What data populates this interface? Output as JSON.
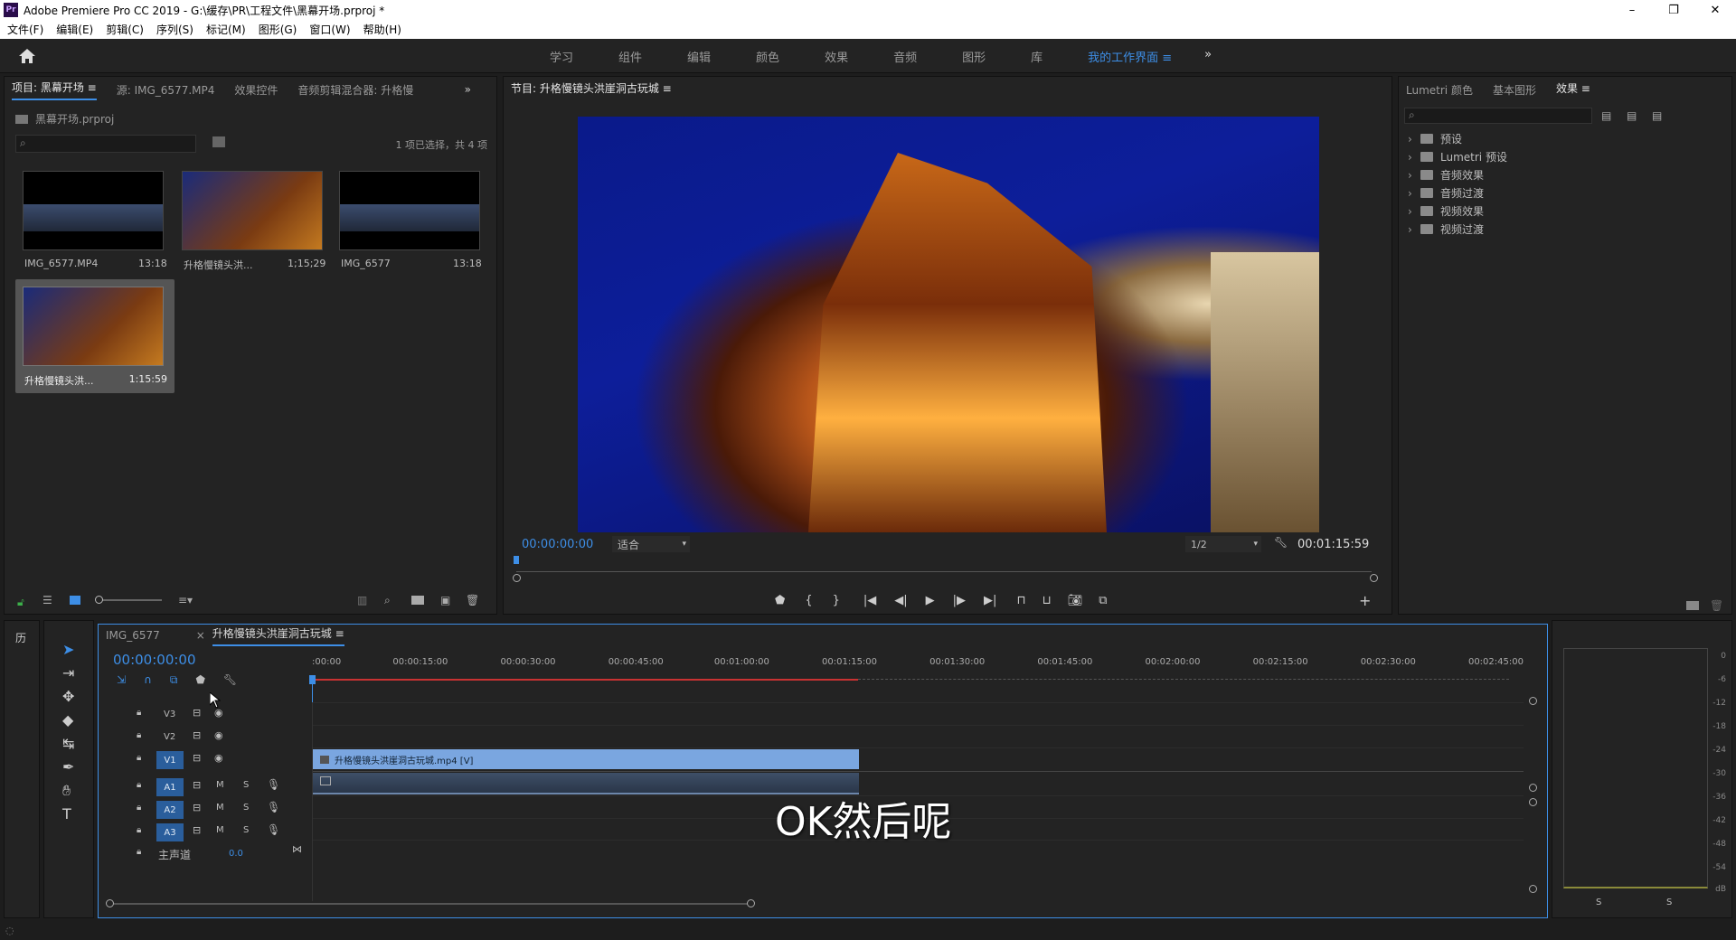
{
  "window": {
    "title": "Adobe Premiere Pro CC 2019 - G:\\缓存\\PR\\工程文件\\黑幕开场.prproj *",
    "logo": "Pr"
  },
  "menu": [
    "文件(F)",
    "编辑(E)",
    "剪辑(C)",
    "序列(S)",
    "标记(M)",
    "图形(G)",
    "窗口(W)",
    "帮助(H)"
  ],
  "workspaces": {
    "items": [
      "学习",
      "组件",
      "编辑",
      "颜色",
      "效果",
      "音频",
      "图形",
      "库"
    ],
    "active": "我的工作界面",
    "more": "»"
  },
  "project": {
    "tabs": [
      "项目: 黑幕开场",
      "源: IMG_6577.MP4",
      "效果控件",
      "音频剪辑混合器: 升格慢"
    ],
    "file": "黑幕开场.prproj",
    "selection_info": "1 项已选择，共 4 项",
    "items": [
      {
        "name": "IMG_6577.MP4",
        "duration": "13:18"
      },
      {
        "name": "升格慢镜头洪...",
        "duration": "1;15;29"
      },
      {
        "name": "IMG_6577",
        "duration": "13:18"
      },
      {
        "name": "升格慢镜头洪...",
        "duration": "1:15:59"
      }
    ]
  },
  "program": {
    "title": "节目: 升格慢镜头洪崖洞古玩城",
    "timecode": "00:00:00:00",
    "fit": "适合",
    "resolution": "1/2",
    "duration": "00:01:15:59"
  },
  "effects": {
    "tabs": [
      "Lumetri 颜色",
      "基本图形",
      "效果"
    ],
    "folders": [
      "预设",
      "Lumetri 预设",
      "音频效果",
      "音频过渡",
      "视频效果",
      "视频过渡"
    ]
  },
  "timeline": {
    "tabs": [
      "IMG_6577",
      "升格慢镜头洪崖洞古玩城"
    ],
    "timecode": "00:00:00:00",
    "ruler": [
      ":00:00",
      "00:00:15:00",
      "00:00:30:00",
      "00:00:45:00",
      "00:01:00:00",
      "00:01:15:00",
      "00:01:30:00",
      "00:01:45:00",
      "00:02:00:00",
      "00:02:15:00",
      "00:02:30:00",
      "00:02:45:00"
    ],
    "video_tracks": [
      "V3",
      "V2",
      "V1"
    ],
    "audio_tracks": [
      "A1",
      "A2",
      "A3"
    ],
    "master": {
      "label": "主声道",
      "value": "0.0"
    },
    "clip": "升格慢镜头洪崖洞古玩城.mp4 [V]",
    "subtitle": "OK然后呢"
  },
  "meter": {
    "scale": [
      "0",
      "-6",
      "-12",
      "-18",
      "-24",
      "-30",
      "-36",
      "-42",
      "-48",
      "-54",
      "dB"
    ],
    "solo": [
      "S",
      "S"
    ]
  },
  "history_label": "历"
}
